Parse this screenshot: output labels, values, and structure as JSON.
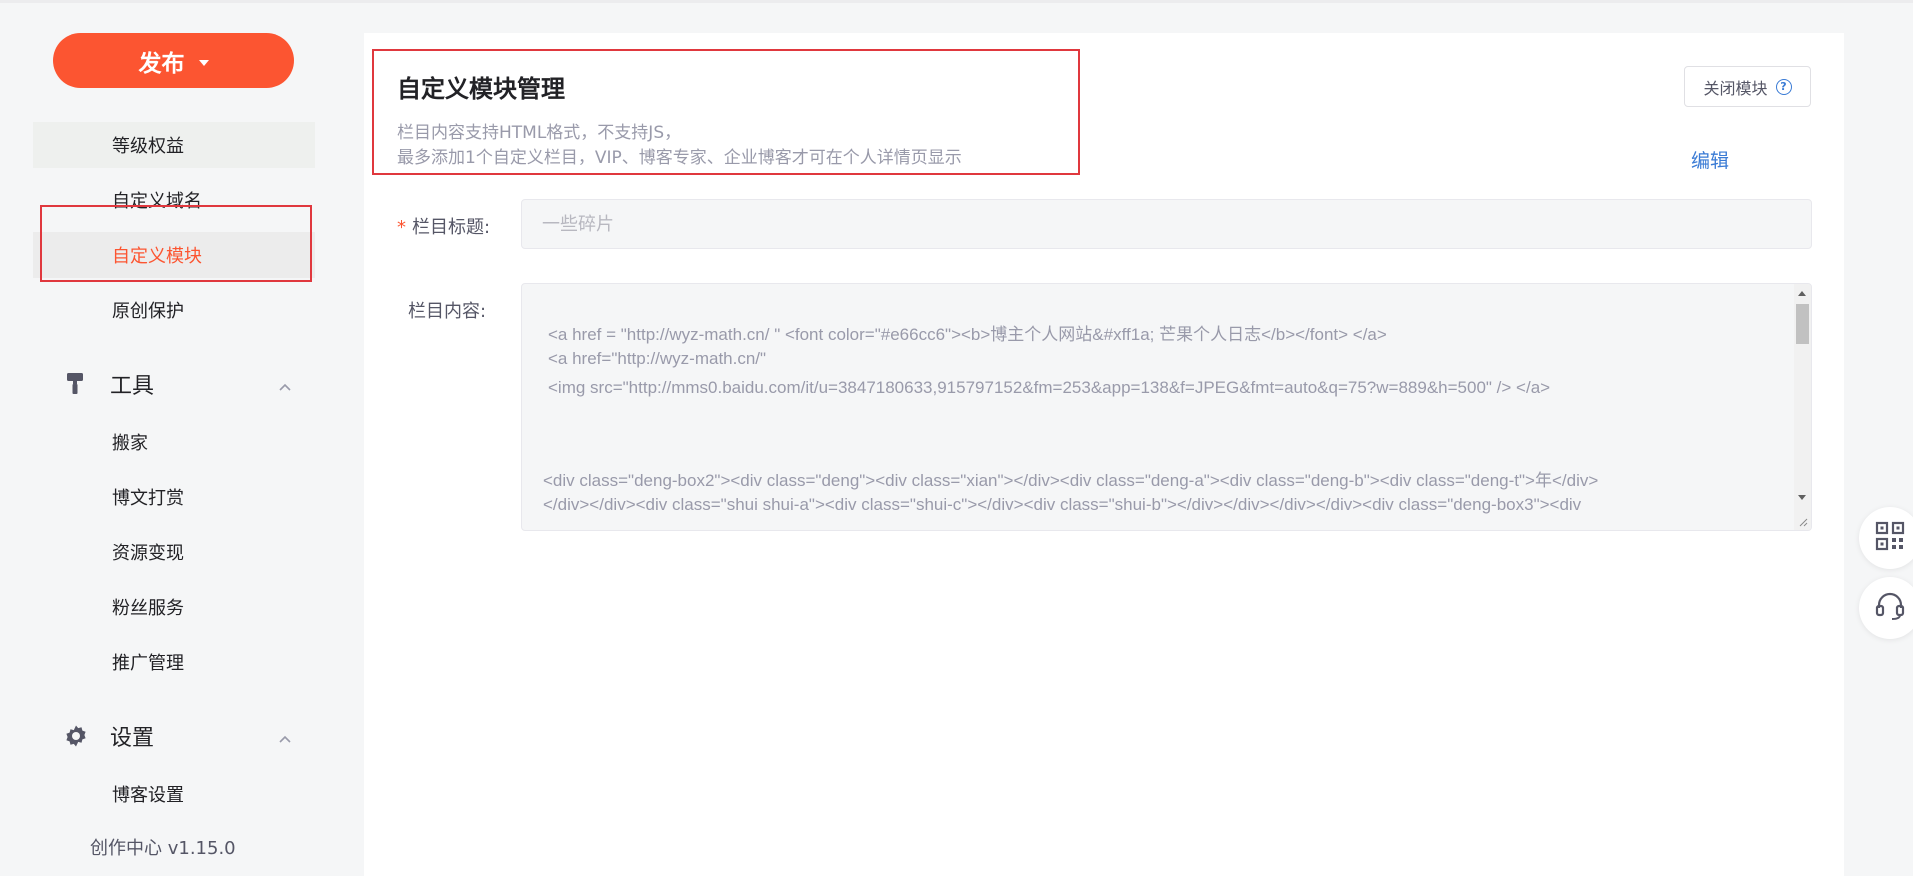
{
  "sidebar": {
    "publish_label": "发布",
    "items_top": [
      {
        "label": "等级权益"
      },
      {
        "label": "自定义域名"
      },
      {
        "label": "自定义模块"
      },
      {
        "label": "原创保护"
      }
    ],
    "tools_section": {
      "label": "工具",
      "items": [
        {
          "label": "搬家"
        },
        {
          "label": "博文打赏"
        },
        {
          "label": "资源变现"
        },
        {
          "label": "粉丝服务"
        },
        {
          "label": "推广管理"
        }
      ]
    },
    "settings_section": {
      "label": "设置",
      "items": [
        {
          "label": "博客设置"
        }
      ]
    },
    "version": "创作中心 v1.15.0"
  },
  "main": {
    "title": "自定义模块管理",
    "desc_line1": "栏目内容支持HTML格式，不支持JS，",
    "desc_line2": "最多添加1个自定义栏目，VIP、博客专家、企业博客才可在个人详情页显示",
    "close_module_label": "关闭模块",
    "edit_label": "编辑",
    "title_field": {
      "label": "栏目标题:",
      "placeholder": "一些碎片"
    },
    "content_field": {
      "label": "栏目内容:",
      "lines": [
        "<a href = \"http://wyz-math.cn/ \" <font color=\"#e66cc6\"><b>博主个人网站&#xff1a; 芒果个人日志</b></font>  </a>",
        "<a href=\"http://wyz-math.cn/\"",
        "<img src=\"http://mms0.baidu.com/it/u=3847180633,915797152&fm=253&app=138&f=JPEG&fmt=auto&q=75?w=889&h=500\" /> </a>",
        "<div class=\"deng-box2\"><div class=\"deng\"><div class=\"xian\"></div><div class=\"deng-a\"><div class=\"deng-b\"><div class=\"deng-t\">年</div>",
        "</div></div><div class=\"shui shui-a\"><div class=\"shui-c\"></div><div class=\"shui-b\"></div></div></div></div><div class=\"deng-box3\"><div"
      ]
    }
  },
  "colors": {
    "accent": "#fc5531",
    "link": "#3a7bd5",
    "highlight_box": "#e0383e"
  },
  "icons": [
    "caret-down-icon",
    "paint-roller-icon",
    "gear-icon",
    "chevron-up-icon",
    "help-circle-icon",
    "qrcode-icon",
    "headset-icon"
  ]
}
